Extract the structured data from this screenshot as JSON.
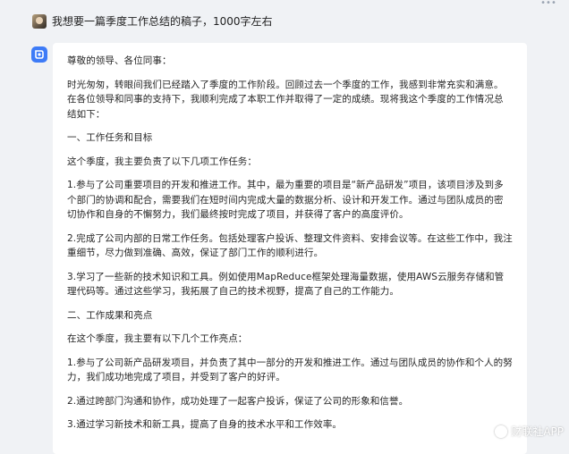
{
  "user_message": {
    "text": "我想要一篇季度工作总结的稿子，1000字左右"
  },
  "answer": {
    "paragraphs": [
      "尊敬的领导、各位同事：",
      "时光匆匆，转眼间我们已经踏入了季度的工作阶段。回顾过去一个季度的工作，我感到非常充实和满意。在各位领导和同事的支持下，我顺利完成了本职工作并取得了一定的成绩。现将我这个季度的工作情况总结如下：",
      "一、工作任务和目标",
      "这个季度，我主要负责了以下几项工作任务：",
      "1.参与了公司重要项目的开发和推进工作。其中，最为重要的项目是“新产品研发”项目，该项目涉及到多个部门的协调和配合，需要我们在短时间内完成大量的数据分析、设计和开发工作。通过与团队成员的密切协作和自身的不懈努力，我们最终按时完成了项目，并获得了客户的高度评价。",
      "2.完成了公司内部的日常工作任务。包括处理客户投诉、整理文件资料、安排会议等。在这些工作中，我注重细节，尽力做到准确、高效，保证了部门工作的顺利进行。",
      "3.学习了一些新的技术知识和工具。例如使用MapReduce框架处理海量数据，使用AWS云服务存储和管理代码等。通过这些学习，我拓展了自己的技术视野，提高了自己的工作能力。",
      "二、工作成果和亮点",
      "在这个季度，我主要有以下几个工作亮点：",
      "1.参与了公司新产品研发项目，并负责了其中一部分的开发和推进工作。通过与团队成员的协作和个人的努力，我们成功地完成了项目，并受到了客户的好评。",
      "2.通过跨部门沟通和协作，成功处理了一起客户投诉，保证了公司的形象和信誉。",
      "3.通过学习新技术和新工具，提高了自身的技术水平和工作效率。"
    ]
  },
  "watermark": {
    "text": "财联社APP"
  },
  "colors": {
    "page_bg": "#f0f2f5",
    "card_bg": "#ffffff",
    "bot_avatar": "#3d7bf7"
  }
}
